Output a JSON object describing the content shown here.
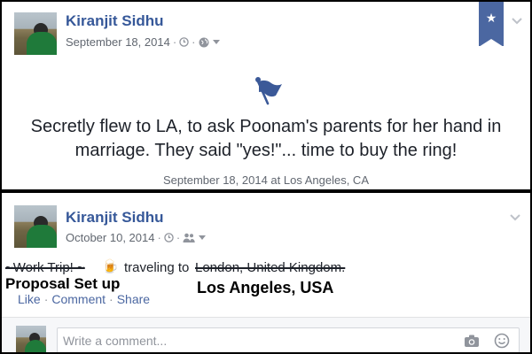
{
  "post1": {
    "author": "Kiranjit Sidhu",
    "date": "September 18, 2014",
    "event_text": "Secretly flew to LA, to ask Poonam's parents for her hand in marriage. They said \"yes!\"... time to buy the ring!",
    "event_subtext": "September 18, 2014 at Los Angeles, CA",
    "icons": [
      "flag-icon",
      "star-icon",
      "globe-icon",
      "clock-icon",
      "chevron-down-icon"
    ]
  },
  "post2": {
    "author": "Kiranjit Sidhu",
    "date": "October 10, 2014",
    "struck_activity": "~Work Trip! ~",
    "activity_emoji": "🍺",
    "activity_verb": "traveling to",
    "struck_location": "London, United Kingdom.",
    "handwritten_activity": "Proposal Set up",
    "handwritten_location": "Los Angeles, USA",
    "actions": {
      "like": "Like",
      "comment": "Comment",
      "share": "Share"
    },
    "comment_placeholder": "Write a comment...",
    "icons": [
      "clock-icon",
      "friends-icon",
      "camera-icon",
      "emoji-icon",
      "chevron-down-icon"
    ]
  },
  "colors": {
    "link_blue": "#365899",
    "bookmark": "#4b67a1",
    "meta_grey": "#90949c",
    "text": "#1d2129"
  }
}
